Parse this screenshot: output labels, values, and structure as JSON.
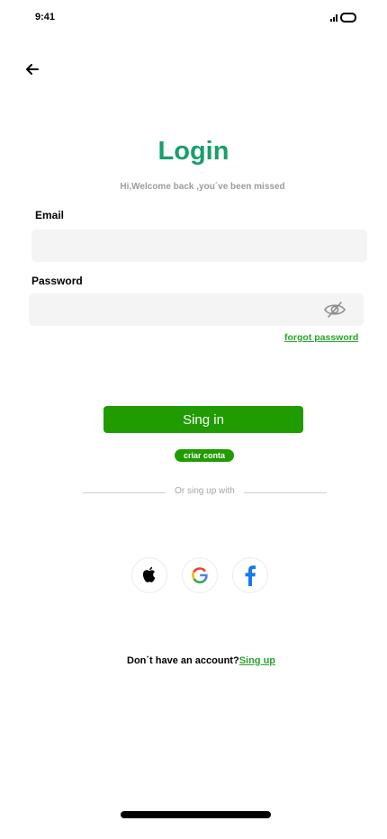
{
  "status_bar": {
    "time": "9:41"
  },
  "header": {
    "back_icon": "arrow-left-icon"
  },
  "title": "Login",
  "subtitle": "Hi,Welcome back ,you´ve been missed",
  "email": {
    "label": "Email",
    "value": "",
    "placeholder": ""
  },
  "password": {
    "label": "Password",
    "value": "",
    "placeholder": "",
    "toggle_icon": "eye-off-icon"
  },
  "forgot_password": "forgot password",
  "signin_button": "Sing in",
  "criar_conta": "criar conta",
  "divider_text": "Or sing up with",
  "social": [
    {
      "name": "apple",
      "icon": "apple-icon"
    },
    {
      "name": "google",
      "icon": "google-icon"
    },
    {
      "name": "facebook",
      "icon": "facebook-icon"
    }
  ],
  "account": {
    "prompt": "Don´t have an account?",
    "link": "Sing up"
  },
  "colors": {
    "title": "#1a9e6b",
    "primary": "#209c00",
    "link": "#2aa52a",
    "input_bg": "#f4f4f4"
  }
}
